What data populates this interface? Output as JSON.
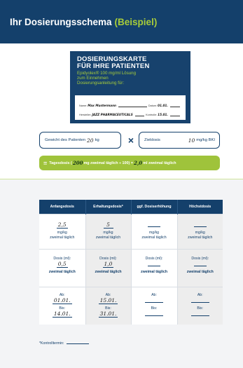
{
  "header": {
    "title": "Ihr Dosierungsschema",
    "title_accent": "(Beispiel)"
  },
  "card": {
    "title_line1": "DOSIERUNGSKARTE",
    "title_line2": "FÜR IHRE PATIENTEN",
    "subtitle_line1": "Epidyolex® 100 mg/ml Lösung",
    "subtitle_line2": "zum Einnehmen",
    "subtitle_line3": "Dosierungsanleitung für:",
    "field_name_label": "Name:",
    "field_name_value": "Max Mustermann",
    "field_date_label": "Datum:",
    "field_date_value": "01.01.",
    "field_row2_label1": "Hersteller:",
    "field_row2_value1": "JAZZ PHARMACEUTICALS",
    "field_row2_label2": "Kontrolle:",
    "field_row2_value2": "15.01."
  },
  "weight": {
    "label": "Gewicht des Patienten",
    "value": "20",
    "unit": "kg"
  },
  "multiply_symbol": "×",
  "target_dose": {
    "label": "Zieldosis",
    "value": "10",
    "unit": "mg/kg BKI"
  },
  "daily_dose": {
    "eq_symbol": "=",
    "label": "Tagesdosis (",
    "value1": "200",
    "text_mid": "mg zweimal täglich ÷ 100) =",
    "value2": "2,0",
    "text_end": "ml zweimal täglich"
  },
  "table": {
    "headers": [
      "Anfangsdosis",
      "Erhaltungsdosis*",
      "ggf. Dosiserhöhung",
      "Höchstdosis"
    ],
    "row_mgkg": {
      "values": [
        "2,5",
        "5",
        "",
        ""
      ],
      "unit": "mg/kg",
      "freq": "zweimal täglich"
    },
    "row_ml": {
      "label": "Dosis (ml):",
      "values": [
        "0,5",
        "1,0",
        "",
        ""
      ],
      "freq": "zweimal täglich"
    },
    "row_dates": {
      "from_label": "Ab:",
      "to_label": "Bis:",
      "from_values": [
        "01.01.",
        "15.01.",
        "",
        ""
      ],
      "to_values": [
        "14.01.",
        "31.01.",
        "",
        ""
      ]
    }
  },
  "footnote": {
    "label": "*Kontrolltermin:"
  }
}
